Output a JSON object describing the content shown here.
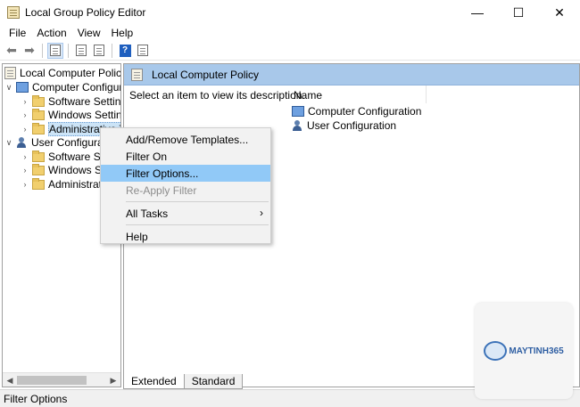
{
  "window": {
    "title": "Local Group Policy Editor",
    "minimize": "—",
    "maximize": "☐",
    "close": "✕"
  },
  "menu": [
    "File",
    "Action",
    "View",
    "Help"
  ],
  "tree": {
    "root": "Local Computer Policy",
    "computer": "Computer Configura",
    "computer_children": [
      "Software Settings",
      "Windows Setting",
      "Administrative Te"
    ],
    "user": "User Configurati",
    "user_children": [
      "Software Set",
      "Windows Se",
      "Administrat"
    ]
  },
  "right_pane": {
    "header": "Local Computer Policy",
    "description": "Select an item to view its description.",
    "column_name": "Name",
    "items": [
      "Computer Configuration",
      "User Configuration"
    ]
  },
  "tabs": [
    "Extended",
    "Standard"
  ],
  "status": "Filter Options",
  "context_menu": {
    "items": [
      {
        "label": "Add/Remove Templates...",
        "state": "normal"
      },
      {
        "label": "Filter On",
        "state": "normal"
      },
      {
        "label": "Filter Options...",
        "state": "highlighted"
      },
      {
        "label": "Re-Apply Filter",
        "state": "disabled"
      },
      {
        "label": "All Tasks",
        "state": "normal"
      },
      {
        "label": "Help",
        "state": "normal"
      }
    ],
    "submenu_arrow": "›"
  },
  "watermark": {
    "brand": "MAYTINH365"
  },
  "colors": {
    "header_bg": "#a8c8ea",
    "menu_highlight": "#91c9f7",
    "tree_selection": "#cce4f7"
  }
}
